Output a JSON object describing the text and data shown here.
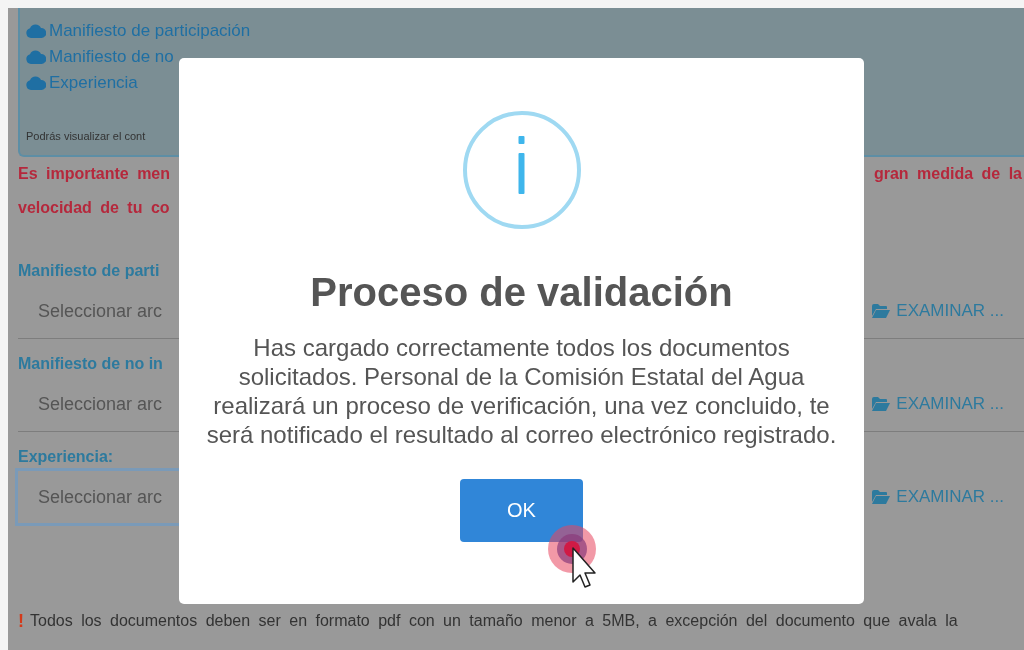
{
  "info_panel": {
    "links": [
      "Manifiesto de participación",
      "Manifiesto de no",
      "Experiencia"
    ],
    "note": "Podrás visualizar el cont"
  },
  "warning": {
    "lines": [
      "Es importante men",
      "velocidad de tu co"
    ],
    "continuation": "gran medida de la"
  },
  "files": [
    {
      "label": "Manifiesto de parti",
      "placeholder": "Seleccionar arc",
      "button": "EXAMINAR ...",
      "focused": false
    },
    {
      "label": "Manifiesto de no in",
      "placeholder": "Seleccionar arc",
      "button": "EXAMINAR ...",
      "focused": false
    },
    {
      "label": "Experiencia:",
      "placeholder": "Seleccionar arc",
      "button": "EXAMINAR ...",
      "focused": true
    }
  ],
  "footnote": {
    "icon": "!",
    "text": "Todos los documentos deben ser en formato pdf con un tamaño menor a 5MB, a excepción del documento que avala la"
  },
  "dialog": {
    "title": "Proceso de validación",
    "message": "Has cargado correctamente todos los documentos solicitados. Personal de la Comisión Estatal del Agua realizará un proceso de verificación, una vez concluido, te será notificado el resultado al correo electrónico registrado.",
    "button": "OK"
  }
}
